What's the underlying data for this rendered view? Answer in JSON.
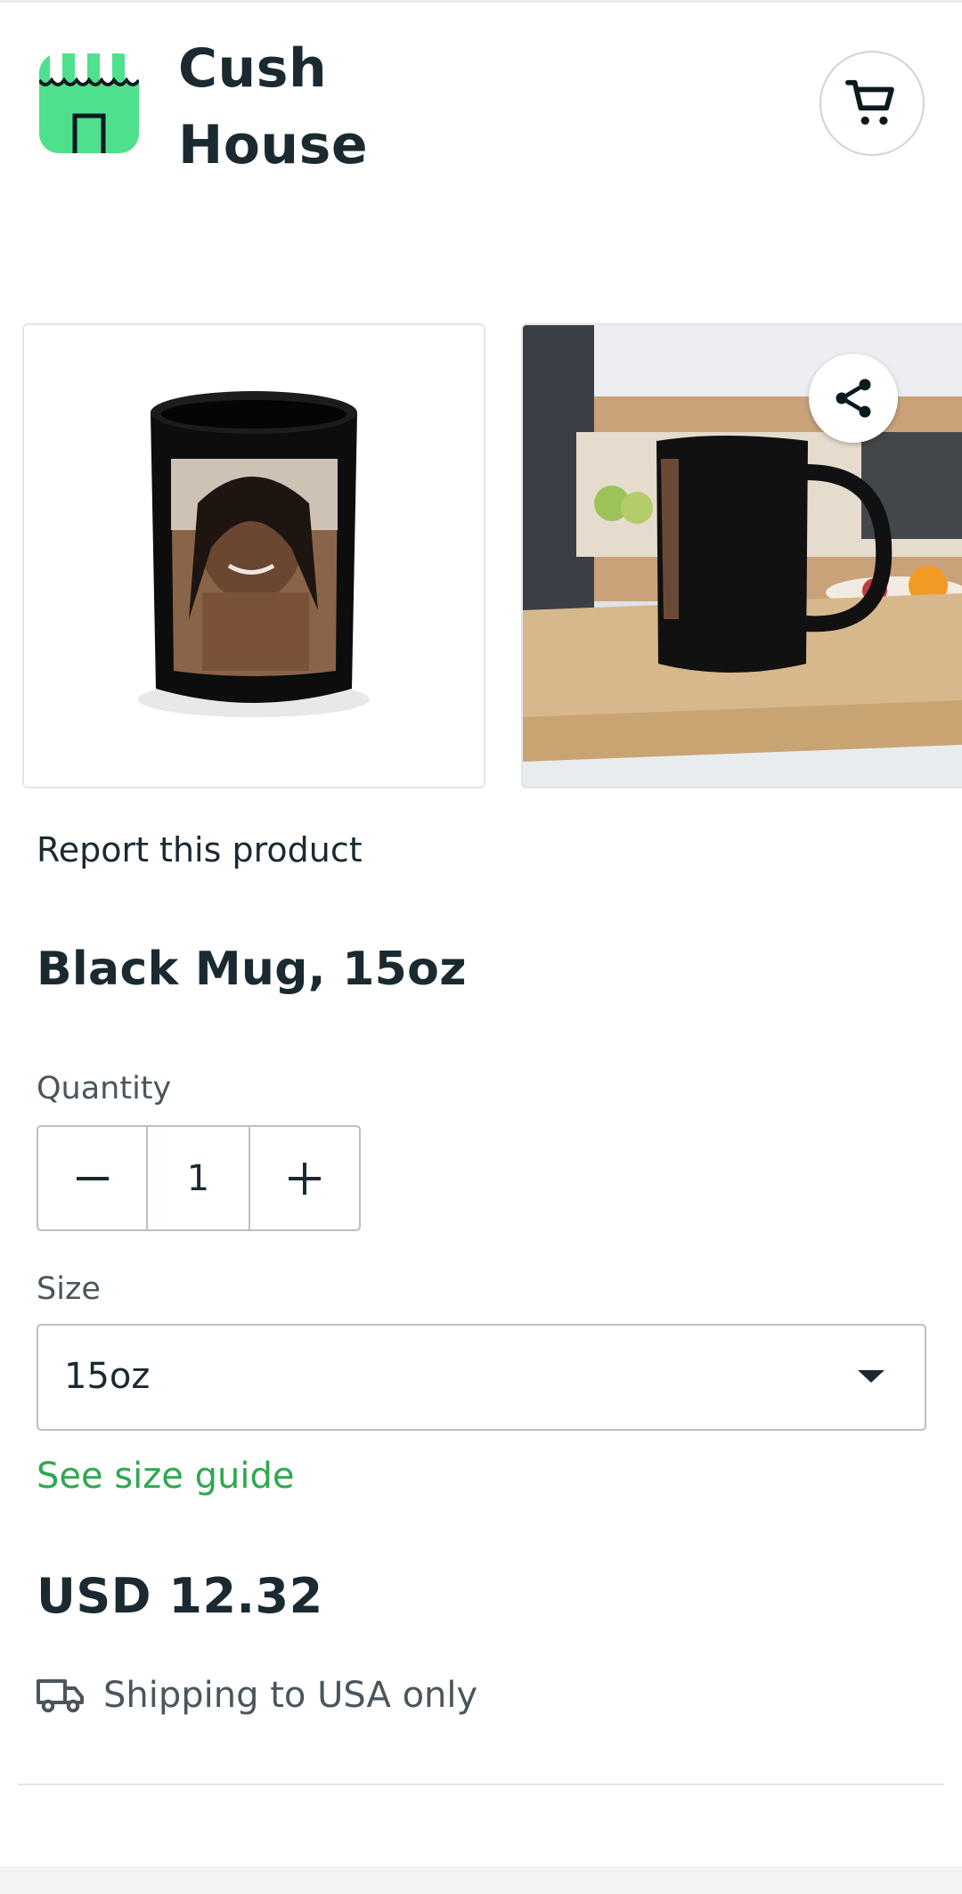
{
  "header": {
    "store_name": "Cush\nHouse",
    "cart_icon": "cart-icon",
    "logo_icon": "storefront-icon"
  },
  "gallery": {
    "images": [
      {
        "description_icon": "mug-photo",
        "alt": "Black Mug, 15oz"
      },
      {
        "description_icon": "mug-photo-kitchen",
        "alt": "Black Mug, 15oz"
      }
    ],
    "share_icon": "share-icon"
  },
  "report_link": "Report this product",
  "product": {
    "title": "Black Mug, 15oz",
    "price": "USD 12.32"
  },
  "quantity": {
    "label": "Quantity",
    "value": "1"
  },
  "size": {
    "label": "Size",
    "selected": "15oz",
    "guide_link": "See size guide"
  },
  "shipping": {
    "text": "Shipping to USA only",
    "icon": "truck-icon"
  },
  "colors": {
    "accent_green": "#2fa84f",
    "logo_green": "#4fe08e",
    "text_dark": "#1a2a30"
  }
}
